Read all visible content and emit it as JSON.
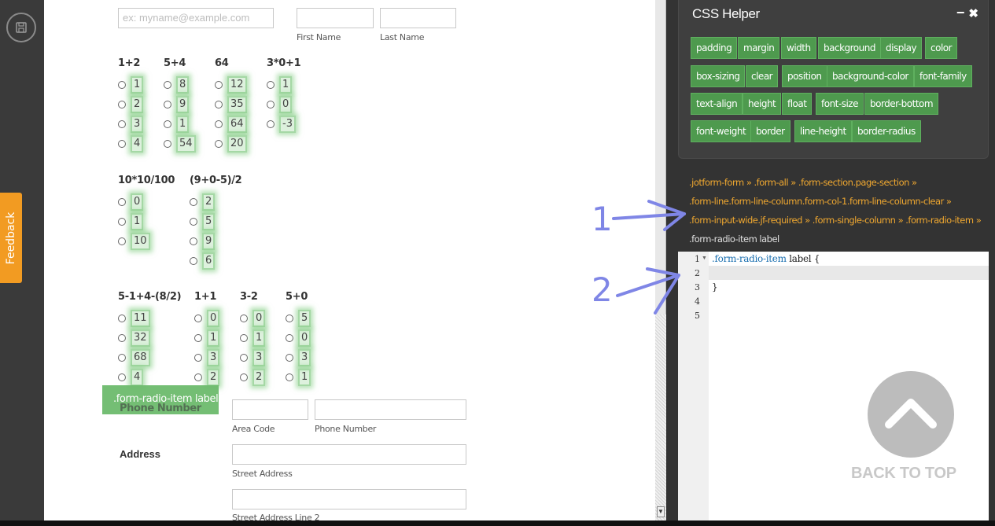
{
  "form": {
    "email_placeholder": "ex: myname@example.com",
    "first_name_sublabel": "First Name",
    "last_name_sublabel": "Last Name",
    "questions_row1": [
      {
        "label": "1+2",
        "options": [
          "1",
          "2",
          "3",
          "4"
        ]
      },
      {
        "label": "5+4",
        "options": [
          "8",
          "9",
          "1",
          "54"
        ]
      },
      {
        "label": "64",
        "options": [
          "12",
          "35",
          "64",
          "20"
        ]
      },
      {
        "label": "3*0+1",
        "options": [
          "1",
          "0",
          "-3"
        ]
      }
    ],
    "questions_row2": [
      {
        "label": "10*10/100",
        "options": [
          "0",
          "1",
          "10"
        ]
      },
      {
        "label": "(9+0-5)/2",
        "options": [
          "2",
          "5",
          "9",
          "6"
        ]
      }
    ],
    "questions_row3": [
      {
        "label": "5-1+4-(8/2)",
        "options": [
          "11",
          "32",
          "68",
          "4"
        ]
      },
      {
        "label": "1+1",
        "options": [
          "0",
          "1",
          "3",
          "2"
        ]
      },
      {
        "label": "3-2",
        "options": [
          "0",
          "1",
          "3",
          "2"
        ]
      },
      {
        "label": "5+0",
        "options": [
          "5",
          "0",
          "3",
          "1"
        ]
      }
    ],
    "hover_tag": ".form-radio-item label",
    "phone_label": "Phone Number",
    "area_code_sublabel": "Area Code",
    "phone_number_sublabel": "Phone Number",
    "address_label": "Address",
    "street_address_sublabel": "Street Address",
    "street_address_2_sublabel": "Street Address Line 2"
  },
  "feedback": {
    "label": "Feedback"
  },
  "css_helper": {
    "title": "CSS Helper",
    "minimize": "−",
    "close": "✖",
    "properties": [
      "padding",
      "margin",
      "width",
      "background",
      "display",
      "color",
      "box-sizing",
      "clear",
      "position",
      "background-color",
      "font-family",
      "text-align",
      "height",
      "float",
      "font-size",
      "border-bottom",
      "font-weight",
      "border",
      "line-height",
      "border-radius"
    ],
    "breadcrumbs": [
      ".jotform-form » .form-all » .form-section.page-section »",
      ".form-line.form-line-column.form-col-1.form-line-column-clear »",
      ".form-input-wide.jf-required » .form-single-column » .form-radio-item »"
    ],
    "current_selector": ".form-radio-item label"
  },
  "editor": {
    "line_numbers": [
      "1",
      "2",
      "3",
      "4",
      "5"
    ],
    "line1_selector": ".form-radio-item",
    "line1_rest": " label {",
    "line3": "}"
  },
  "back_to_top": {
    "label": "BACK TO TOP"
  },
  "annotations": {
    "one": "1",
    "two": "2"
  },
  "colors": {
    "accent_green": "#4e9a4e",
    "breadcrumb_orange": "#f0a830",
    "feedback_orange": "#f29b22",
    "annotation_blue": "#7f86e6"
  }
}
